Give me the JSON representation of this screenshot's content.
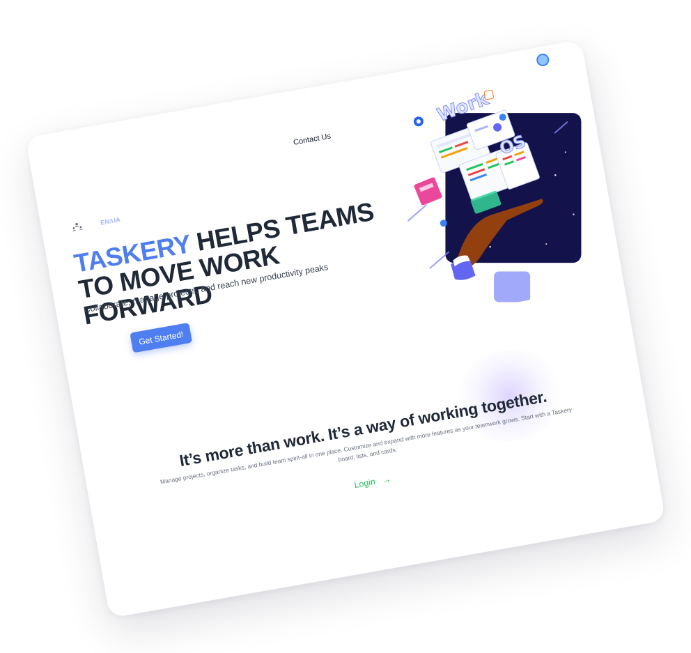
{
  "nav": {
    "contact_label": "Contact Us",
    "lang_en": "EN",
    "lang_separator": "/",
    "lang_ua": "UA"
  },
  "hero": {
    "brand": "TASKERY",
    "headline_rest": " HELPS TEAMS TO MOVE WORK FORWARD",
    "subtitle": "Collaborate, manage projects, and reach new productivity peaks",
    "cta_label": "Get Started!",
    "illustration": {
      "title_word1": "Work",
      "title_word2": "OS"
    }
  },
  "about": {
    "title": "It’s more than work. It’s a way of working together.",
    "description": "Manage projects, organize tasks, and build team spirit-all in one place. Customize and expand with more features as your teamwork grows. Start with a Taskery board, lists, and cards.",
    "login_label": "Login",
    "login_arrow": "→"
  },
  "colors": {
    "brand_blue": "#4f7ef0",
    "heading_dark": "#1f2937",
    "login_green": "#22c55e",
    "lang_purple": "#a5b4fc",
    "illustration_navy": "#14124a"
  },
  "icons": {
    "logo": "team-people-icon",
    "avatar": "avatar-circle-icon",
    "login_arrow": "arrow-right-icon"
  }
}
